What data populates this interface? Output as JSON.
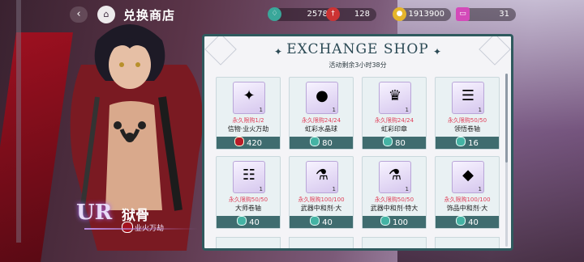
{
  "header": {
    "title": "兑换商店",
    "back_icon": "back-arrow-icon",
    "shop_icon": "shop-building-icon"
  },
  "resources": [
    {
      "icon": "teal-potion-icon",
      "value": "2578"
    },
    {
      "icon": "red-sword-icon",
      "value": "128"
    },
    {
      "icon": "gold-coin-icon",
      "value": "1913900"
    },
    {
      "icon": "pink-ticket-icon",
      "value": "31"
    }
  ],
  "character": {
    "rarity": "UR",
    "name": "狱骨",
    "subtitle": "业火万劫"
  },
  "shop": {
    "title": "EXCHANGE SHOP",
    "timer": "活动剩余3小时38分",
    "items": [
      {
        "limit": "永久限购1/2",
        "name": "信物·业火万劫",
        "price": "420",
        "currency": "red",
        "count": "1",
        "glyph": "✦"
      },
      {
        "limit": "永久限购24/24",
        "name": "虹彩水晶球",
        "price": "80",
        "currency": "teal",
        "count": "1",
        "glyph": "●"
      },
      {
        "limit": "永久限购24/24",
        "name": "虹彩印章",
        "price": "80",
        "currency": "teal",
        "count": "1",
        "glyph": "♛"
      },
      {
        "limit": "永久限购50/50",
        "name": "领悟卷轴",
        "price": "16",
        "currency": "teal",
        "count": "1",
        "glyph": "☰"
      },
      {
        "limit": "永久限购50/50",
        "name": "大师卷轴",
        "price": "40",
        "currency": "teal",
        "count": "1",
        "glyph": "☷"
      },
      {
        "limit": "永久限购100/100",
        "name": "武器中和剂·大",
        "price": "40",
        "currency": "teal",
        "count": "1",
        "glyph": "⚗"
      },
      {
        "limit": "永久限购50/50",
        "name": "武器中和剂·特大",
        "price": "100",
        "currency": "teal",
        "count": "1",
        "glyph": "⚗"
      },
      {
        "limit": "永久限购100/100",
        "name": "饰品中和剂·大",
        "price": "40",
        "currency": "teal",
        "count": "1",
        "glyph": "◆"
      }
    ]
  },
  "colors": {
    "panel_border": "#2f5a5e",
    "price_bar": "#3f6c6f",
    "limit_text": "#e0415a"
  }
}
